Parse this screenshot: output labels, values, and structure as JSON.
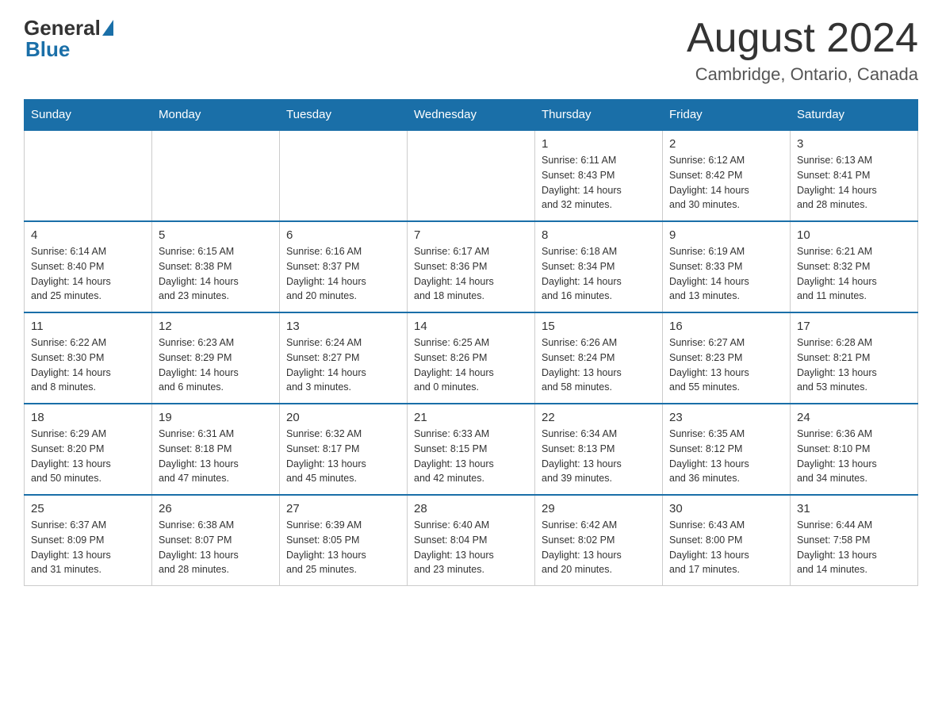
{
  "header": {
    "logo_general": "General",
    "logo_blue": "Blue",
    "month_title": "August 2024",
    "location": "Cambridge, Ontario, Canada"
  },
  "weekdays": [
    "Sunday",
    "Monday",
    "Tuesday",
    "Wednesday",
    "Thursday",
    "Friday",
    "Saturday"
  ],
  "weeks": [
    [
      {
        "day": "",
        "info": ""
      },
      {
        "day": "",
        "info": ""
      },
      {
        "day": "",
        "info": ""
      },
      {
        "day": "",
        "info": ""
      },
      {
        "day": "1",
        "info": "Sunrise: 6:11 AM\nSunset: 8:43 PM\nDaylight: 14 hours\nand 32 minutes."
      },
      {
        "day": "2",
        "info": "Sunrise: 6:12 AM\nSunset: 8:42 PM\nDaylight: 14 hours\nand 30 minutes."
      },
      {
        "day": "3",
        "info": "Sunrise: 6:13 AM\nSunset: 8:41 PM\nDaylight: 14 hours\nand 28 minutes."
      }
    ],
    [
      {
        "day": "4",
        "info": "Sunrise: 6:14 AM\nSunset: 8:40 PM\nDaylight: 14 hours\nand 25 minutes."
      },
      {
        "day": "5",
        "info": "Sunrise: 6:15 AM\nSunset: 8:38 PM\nDaylight: 14 hours\nand 23 minutes."
      },
      {
        "day": "6",
        "info": "Sunrise: 6:16 AM\nSunset: 8:37 PM\nDaylight: 14 hours\nand 20 minutes."
      },
      {
        "day": "7",
        "info": "Sunrise: 6:17 AM\nSunset: 8:36 PM\nDaylight: 14 hours\nand 18 minutes."
      },
      {
        "day": "8",
        "info": "Sunrise: 6:18 AM\nSunset: 8:34 PM\nDaylight: 14 hours\nand 16 minutes."
      },
      {
        "day": "9",
        "info": "Sunrise: 6:19 AM\nSunset: 8:33 PM\nDaylight: 14 hours\nand 13 minutes."
      },
      {
        "day": "10",
        "info": "Sunrise: 6:21 AM\nSunset: 8:32 PM\nDaylight: 14 hours\nand 11 minutes."
      }
    ],
    [
      {
        "day": "11",
        "info": "Sunrise: 6:22 AM\nSunset: 8:30 PM\nDaylight: 14 hours\nand 8 minutes."
      },
      {
        "day": "12",
        "info": "Sunrise: 6:23 AM\nSunset: 8:29 PM\nDaylight: 14 hours\nand 6 minutes."
      },
      {
        "day": "13",
        "info": "Sunrise: 6:24 AM\nSunset: 8:27 PM\nDaylight: 14 hours\nand 3 minutes."
      },
      {
        "day": "14",
        "info": "Sunrise: 6:25 AM\nSunset: 8:26 PM\nDaylight: 14 hours\nand 0 minutes."
      },
      {
        "day": "15",
        "info": "Sunrise: 6:26 AM\nSunset: 8:24 PM\nDaylight: 13 hours\nand 58 minutes."
      },
      {
        "day": "16",
        "info": "Sunrise: 6:27 AM\nSunset: 8:23 PM\nDaylight: 13 hours\nand 55 minutes."
      },
      {
        "day": "17",
        "info": "Sunrise: 6:28 AM\nSunset: 8:21 PM\nDaylight: 13 hours\nand 53 minutes."
      }
    ],
    [
      {
        "day": "18",
        "info": "Sunrise: 6:29 AM\nSunset: 8:20 PM\nDaylight: 13 hours\nand 50 minutes."
      },
      {
        "day": "19",
        "info": "Sunrise: 6:31 AM\nSunset: 8:18 PM\nDaylight: 13 hours\nand 47 minutes."
      },
      {
        "day": "20",
        "info": "Sunrise: 6:32 AM\nSunset: 8:17 PM\nDaylight: 13 hours\nand 45 minutes."
      },
      {
        "day": "21",
        "info": "Sunrise: 6:33 AM\nSunset: 8:15 PM\nDaylight: 13 hours\nand 42 minutes."
      },
      {
        "day": "22",
        "info": "Sunrise: 6:34 AM\nSunset: 8:13 PM\nDaylight: 13 hours\nand 39 minutes."
      },
      {
        "day": "23",
        "info": "Sunrise: 6:35 AM\nSunset: 8:12 PM\nDaylight: 13 hours\nand 36 minutes."
      },
      {
        "day": "24",
        "info": "Sunrise: 6:36 AM\nSunset: 8:10 PM\nDaylight: 13 hours\nand 34 minutes."
      }
    ],
    [
      {
        "day": "25",
        "info": "Sunrise: 6:37 AM\nSunset: 8:09 PM\nDaylight: 13 hours\nand 31 minutes."
      },
      {
        "day": "26",
        "info": "Sunrise: 6:38 AM\nSunset: 8:07 PM\nDaylight: 13 hours\nand 28 minutes."
      },
      {
        "day": "27",
        "info": "Sunrise: 6:39 AM\nSunset: 8:05 PM\nDaylight: 13 hours\nand 25 minutes."
      },
      {
        "day": "28",
        "info": "Sunrise: 6:40 AM\nSunset: 8:04 PM\nDaylight: 13 hours\nand 23 minutes."
      },
      {
        "day": "29",
        "info": "Sunrise: 6:42 AM\nSunset: 8:02 PM\nDaylight: 13 hours\nand 20 minutes."
      },
      {
        "day": "30",
        "info": "Sunrise: 6:43 AM\nSunset: 8:00 PM\nDaylight: 13 hours\nand 17 minutes."
      },
      {
        "day": "31",
        "info": "Sunrise: 6:44 AM\nSunset: 7:58 PM\nDaylight: 13 hours\nand 14 minutes."
      }
    ]
  ]
}
